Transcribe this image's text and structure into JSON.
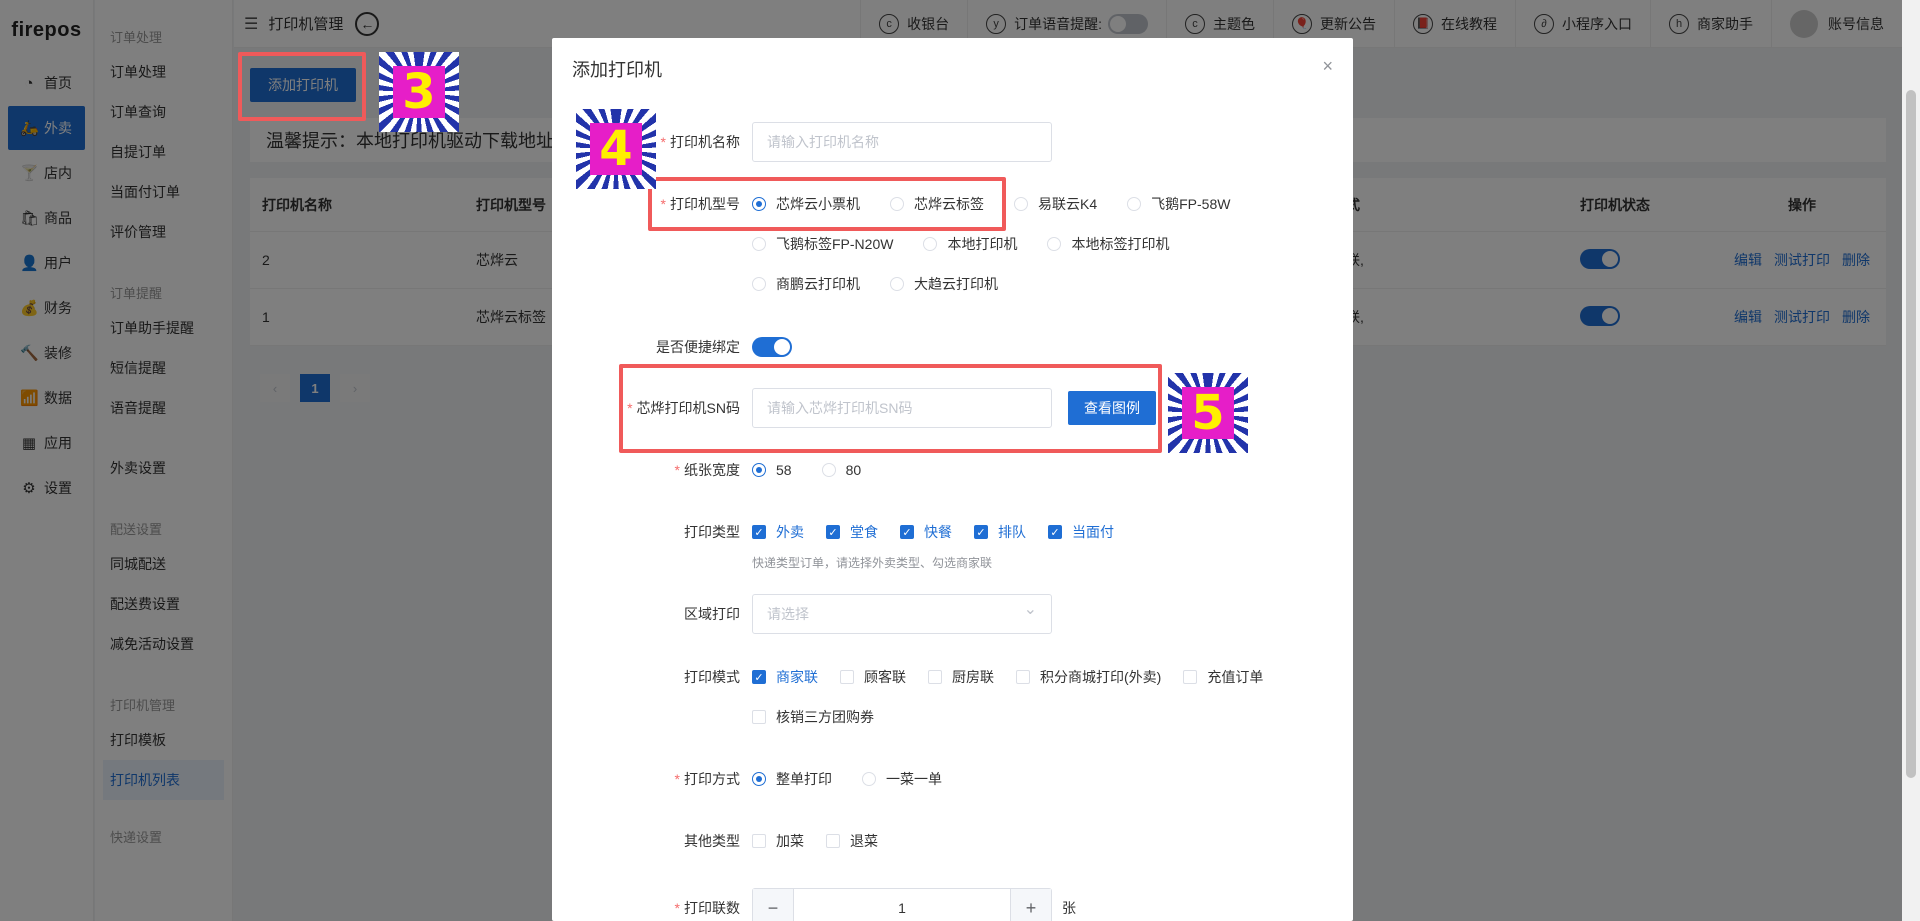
{
  "app": {
    "logo": "firepos"
  },
  "rail": [
    {
      "label": "首页",
      "icon": "◔"
    },
    {
      "label": "外卖",
      "icon": "🛵",
      "active": true
    },
    {
      "label": "店内",
      "icon": "🍸"
    },
    {
      "label": "商品",
      "icon": "🛍"
    },
    {
      "label": "用户",
      "icon": "👤"
    },
    {
      "label": "财务",
      "icon": "💰"
    },
    {
      "label": "装修",
      "icon": "🔨"
    },
    {
      "label": "数据",
      "icon": "📶"
    },
    {
      "label": "应用",
      "icon": "▦"
    },
    {
      "label": "设置",
      "icon": "⚙"
    }
  ],
  "submenu": {
    "group1": "订单处理",
    "g1_items": [
      "订单处理",
      "订单查询",
      "自提订单",
      "当面付订单",
      "评价管理"
    ],
    "group2": "订单提醒",
    "g2_items": [
      "订单助手提醒",
      "短信提醒",
      "语音提醒"
    ],
    "standalone": "外卖设置",
    "group3": "配送设置",
    "g3_items": [
      "同城配送",
      "配送费设置",
      "减免活动设置"
    ],
    "group4": "打印机管理",
    "g4_items": [
      "打印模板",
      "打印机列表"
    ],
    "group5": "快递设置"
  },
  "topbar": {
    "title": "打印机管理",
    "items": [
      {
        "label": "收银台",
        "icon": "c"
      },
      {
        "label": "订单语音提醒:",
        "icon": "y"
      },
      {
        "label": "主题色",
        "icon": "c"
      },
      {
        "label": "更新公告",
        "icon": "🎈"
      },
      {
        "label": "在线教程",
        "icon": "📕"
      },
      {
        "label": "小程序入口",
        "icon": "∂"
      },
      {
        "label": "商家助手",
        "icon": "h"
      },
      {
        "label": "账号信息",
        "icon": ""
      }
    ]
  },
  "main": {
    "add_button": "添加打印机",
    "tip": "温馨提示：本地打印机驱动下载地址",
    "columns": [
      "打印机名称",
      "打印机型号",
      "式",
      "打印机状态",
      "操作"
    ],
    "rows": [
      {
        "name": "2",
        "model": "芯烨云",
        "mode": "联,",
        "ops": [
          "编辑",
          "测试打印",
          "删除"
        ]
      },
      {
        "name": "1",
        "model": "芯烨云标签",
        "mode": "联,",
        "ops": [
          "编辑",
          "测试打印",
          "删除"
        ]
      }
    ],
    "pager": {
      "prev": "‹",
      "current": "1",
      "next": "›"
    }
  },
  "modal": {
    "title": "添加打印机",
    "close": "×",
    "fields": {
      "name_label": "打印机名称",
      "name_placeholder": "请输入打印机名称",
      "model_label": "打印机型号",
      "models": [
        "芯烨云小票机",
        "芯烨云标签",
        "易联云K4",
        "飞鹅FP-58W",
        "飞鹅标签FP-N20W",
        "本地打印机",
        "本地标签打印机",
        "商鹏云打印机",
        "大趋云打印机"
      ],
      "quick_bind_label": "是否便捷绑定",
      "sn_label": "芯烨打印机SN码",
      "sn_placeholder": "请输入芯烨打印机SN码",
      "sn_button": "查看图例",
      "paper_label": "纸张宽度",
      "papers": [
        "58",
        "80"
      ],
      "print_type_label": "打印类型",
      "print_types": [
        "外卖",
        "堂食",
        "快餐",
        "排队",
        "当面付"
      ],
      "print_type_hint": "快递类型订单，请选择外卖类型、勾选商家联",
      "area_label": "区域打印",
      "area_placeholder": "请选择",
      "print_mode_label": "打印模式",
      "print_modes": [
        "商家联",
        "顾客联",
        "厨房联",
        "积分商城打印(外卖)",
        "充值订单",
        "核销三方团购券"
      ],
      "method_label": "打印方式",
      "methods": [
        "整单打印",
        "一菜一单"
      ],
      "other_label": "其他类型",
      "others": [
        "加菜",
        "退菜"
      ],
      "copies_label": "打印联数",
      "copies_value": "1",
      "copies_unit": "张"
    }
  },
  "badges": [
    "3",
    "4",
    "5"
  ]
}
